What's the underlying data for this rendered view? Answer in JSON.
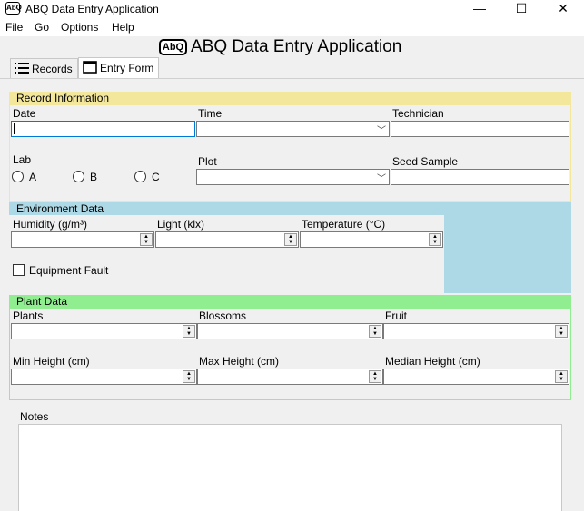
{
  "window": {
    "title": "ABQ Data Entry Application",
    "icon_text": "AbQ",
    "minimize": "—",
    "maximize": "☐",
    "close": "✕"
  },
  "menu": [
    "File",
    "Go",
    "Options",
    "Help"
  ],
  "heading": {
    "logo_text": "AbQ",
    "title": "ABQ Data Entry Application"
  },
  "tabs": [
    {
      "label": "Records",
      "icon": "list-icon"
    },
    {
      "label": "Entry Form",
      "icon": "form-icon"
    }
  ],
  "record_info": {
    "title": "Record Information",
    "date_label": "Date",
    "time_label": "Time",
    "technician_label": "Technician",
    "lab_label": "Lab",
    "labs": [
      "A",
      "B",
      "C"
    ],
    "plot_label": "Plot",
    "seed_label": "Seed Sample",
    "color": "#f3e79b"
  },
  "environment": {
    "title": "Environment Data",
    "humidity_label": "Humidity (g/m³)",
    "light_label": "Light (klx)",
    "temperature_label": "Temperature (°C)",
    "equipment_fault_label": "Equipment Fault",
    "color": "#add8e6"
  },
  "plant": {
    "title": "Plant Data",
    "plants_label": "Plants",
    "blossoms_label": "Blossoms",
    "fruit_label": "Fruit",
    "min_height_label": "Min Height (cm)",
    "max_height_label": "Max Height (cm)",
    "median_height_label": "Median Height (cm)",
    "color": "#90ee90"
  },
  "notes": {
    "label": "Notes"
  }
}
